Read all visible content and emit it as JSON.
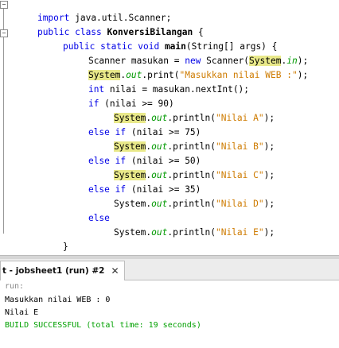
{
  "editor": {
    "lines": {
      "l1": {
        "t1": "import ",
        "t2": "java.util.Scanner;"
      },
      "l2": {
        "t1": "public class ",
        "t2": "KonversiBilangan",
        "t3": " {"
      },
      "l3": {
        "t1": "public static void ",
        "t2": "main",
        "t3": "(String[] args) {"
      },
      "l4": {
        "t1": "Scanner masukan = ",
        "t2": "new",
        "t3": " Scanner(",
        "t4": "System",
        "t5": ".",
        "t6": "in",
        "t7": ");"
      },
      "l5": {
        "t1": "System",
        "t2": ".",
        "t3": "out",
        "t4": ".print(",
        "t5": "\"Masukkan nilai WEB :\"",
        "t6": ");"
      },
      "l6": {
        "t1": "int",
        "t2": " nilai = masukan.nextInt();"
      },
      "l7": {
        "t1": "if",
        "t2": " (nilai >= 90)"
      },
      "l8": {
        "t1": "System",
        "t2": ".",
        "t3": "out",
        "t4": ".println(",
        "t5": "\"Nilai A\"",
        "t6": ");"
      },
      "l9": {
        "t1": "else if",
        "t2": " (nilai >= 75)"
      },
      "l10": {
        "t1": "System",
        "t2": ".",
        "t3": "out",
        "t4": ".println(",
        "t5": "\"Nilai B\"",
        "t6": ");"
      },
      "l11": {
        "t1": "else if",
        "t2": " (nilai >= 50)"
      },
      "l12": {
        "t1": "System",
        "t2": ".",
        "t3": "out",
        "t4": ".println(",
        "t5": "\"Nilai C\"",
        "t6": ");"
      },
      "l13": {
        "t1": "else if",
        "t2": " (nilai >= 35)"
      },
      "l14": {
        "t1": "System",
        "t2": ".",
        "t3": "out",
        "t4": ".println(",
        "t5": "\"Nilai D\"",
        "t6": ");"
      },
      "l15": {
        "t1": "else"
      },
      "l16": {
        "t1": "System",
        "t2": ".",
        "t3": "out",
        "t4": ".println(",
        "t5": "\"Nilai E\"",
        "t6": ");"
      },
      "l17": {
        "t1": "}"
      },
      "l18": {
        "t1": "}"
      }
    },
    "fold_marker": "−"
  },
  "output_panel": {
    "tab_label": "t - jobsheet1 (run) #2",
    "close_label": "✕",
    "lines": {
      "o1": "run:",
      "o2": "Masukkan nilai WEB : 0",
      "o3": "Nilai E",
      "o4": "BUILD SUCCESSFUL (total time: 19 seconds)"
    },
    "colors": {
      "run": "#888888",
      "text": "#000000",
      "success": "#00a000"
    }
  }
}
